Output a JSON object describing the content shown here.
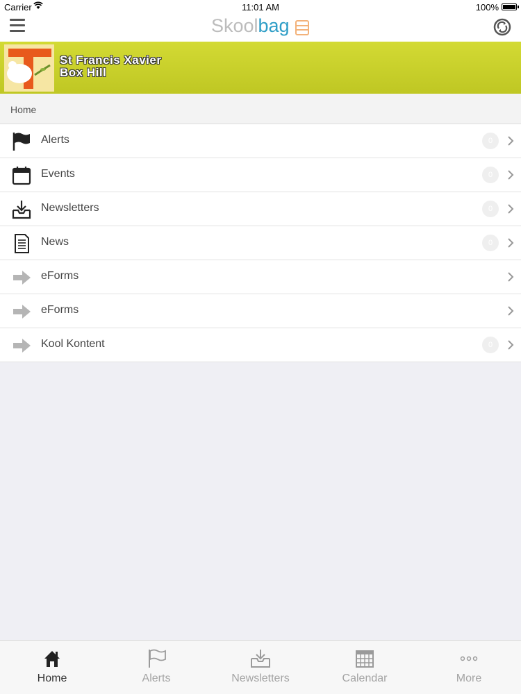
{
  "status_bar": {
    "carrier": "Carrier",
    "time": "11:01 AM",
    "battery": "100%"
  },
  "nav": {
    "brand_part1": "Skool",
    "brand_part2": "bag"
  },
  "banner": {
    "school_line1": "St Francis Xavier",
    "school_line2": "Box Hill",
    "color": "#c8cf2a"
  },
  "breadcrumb": {
    "label": "Home"
  },
  "menu_items": [
    {
      "label": "Alerts",
      "icon": "flag-icon",
      "badge": "0"
    },
    {
      "label": "Events",
      "icon": "calendar-icon",
      "badge": "0"
    },
    {
      "label": "Newsletters",
      "icon": "inbox-download-icon",
      "badge": "0"
    },
    {
      "label": "News",
      "icon": "document-icon",
      "badge": "0"
    },
    {
      "label": "eForms",
      "icon": "arrow-right-icon",
      "badge": ""
    },
    {
      "label": "eForms",
      "icon": "arrow-right-icon",
      "badge": ""
    },
    {
      "label": "Kool Kontent",
      "icon": "arrow-right-icon",
      "badge": "0"
    }
  ],
  "tabs": [
    {
      "label": "Home",
      "icon": "home-icon",
      "active": true
    },
    {
      "label": "Alerts",
      "icon": "flag-icon",
      "active": false
    },
    {
      "label": "Newsletters",
      "icon": "inbox-download-icon",
      "active": false
    },
    {
      "label": "Calendar",
      "icon": "calendar-grid-icon",
      "active": false
    },
    {
      "label": "More",
      "icon": "more-dots-icon",
      "active": false
    }
  ],
  "colors": {
    "brand_blue": "#2f9ec7",
    "banner_green": "#c8cf2a",
    "tab_inactive": "#a3a3a3"
  }
}
